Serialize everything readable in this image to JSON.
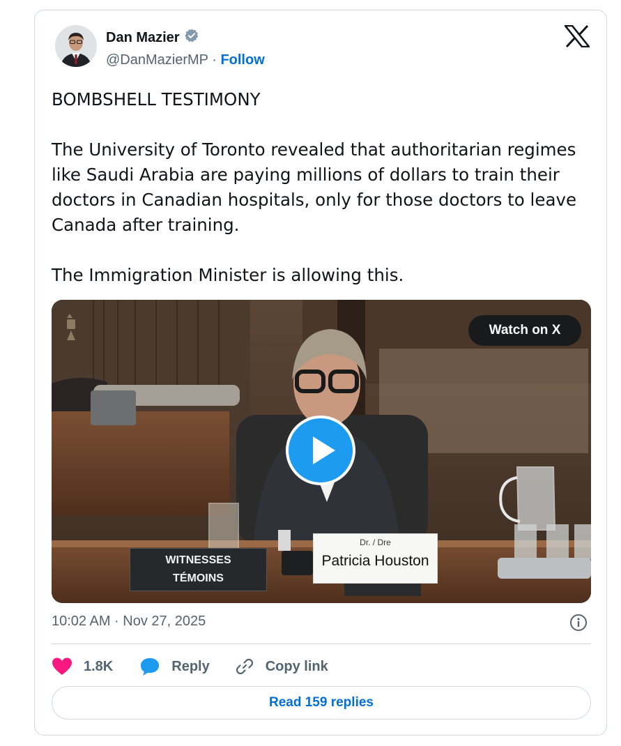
{
  "author": {
    "name": "Dan Mazier",
    "handle": "@DanMazierMP",
    "separator": "·",
    "follow_label": "Follow",
    "avatar_icon": "profile-photo",
    "verified_icon": "verified-badge-icon"
  },
  "brand": {
    "logo_icon": "x-logo-icon"
  },
  "tweet": {
    "paragraphs": [
      "BOMBSHELL TESTIMONY",
      "The University of Toronto revealed that authoritarian regimes like Saudi Arabia are paying millions of dollars to train their doctors in Canadian hospitals, only for those doctors to leave Canada after training.",
      "The Immigration Minister is allowing this."
    ]
  },
  "media": {
    "watch_label": "Watch on X",
    "play_icon": "play-icon",
    "nameplate": {
      "title": "Dr. / Dre",
      "name": "Patricia Houston"
    },
    "witness_sign": {
      "line1": "WITNESSES",
      "line2": "TÉMOINS"
    }
  },
  "meta": {
    "timestamp": "10:02 AM · Nov 27, 2025",
    "info_icon": "info-icon"
  },
  "actions": {
    "like_count": "1.8K",
    "reply_label": "Reply",
    "copy_label": "Copy link"
  },
  "read_replies_label": "Read 159 replies",
  "colors": {
    "accent": "#006fd6",
    "play": "#1d9bf0",
    "like": "#f91880",
    "muted": "#536471",
    "border": "#cfd9de"
  }
}
